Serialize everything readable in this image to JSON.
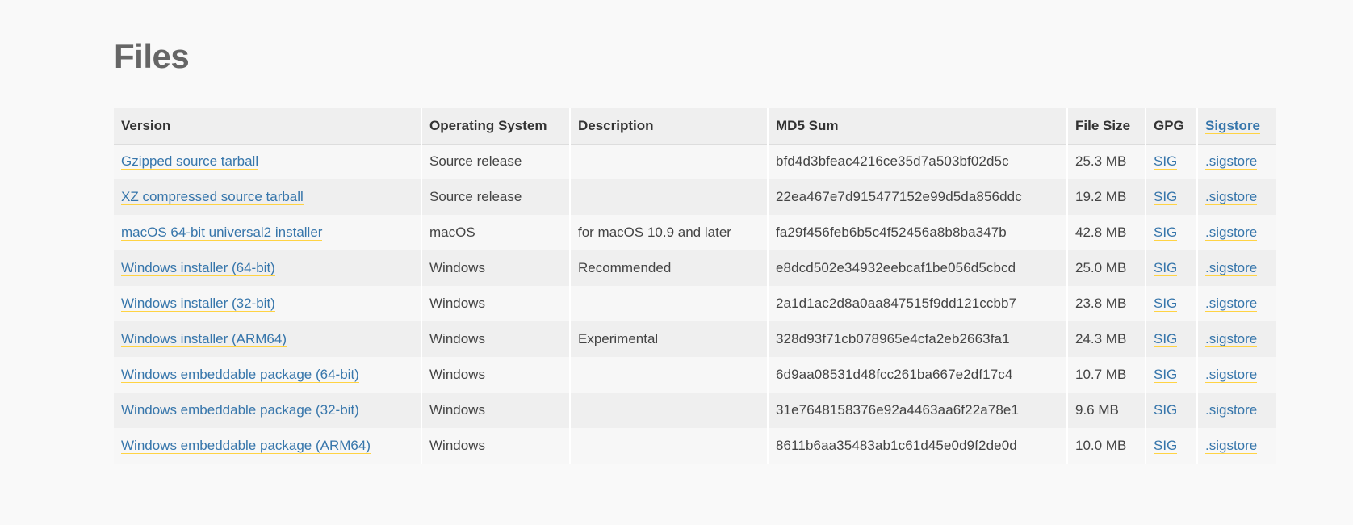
{
  "page": {
    "title": "Files"
  },
  "colors": {
    "link": "#3776ab",
    "link_underline": "#ffd343",
    "heading": "#666666",
    "header_bg": "#efefef",
    "row_alt_bg": "#efefef",
    "row_bg": "#f7f7f7",
    "page_bg": "#f9f9f9"
  },
  "table": {
    "headers": {
      "version": "Version",
      "os": "Operating System",
      "description": "Description",
      "md5": "MD5 Sum",
      "size": "File Size",
      "gpg": "GPG",
      "sigstore": "Sigstore"
    },
    "rows": [
      {
        "version": "Gzipped source tarball",
        "os": "Source release",
        "description": "",
        "md5": "bfd4d3bfeac4216ce35d7a503bf02d5c",
        "size": "25.3 MB",
        "gpg": "SIG",
        "sigstore": ".sigstore"
      },
      {
        "version": "XZ compressed source tarball",
        "os": "Source release",
        "description": "",
        "md5": "22ea467e7d915477152e99d5da856ddc",
        "size": "19.2 MB",
        "gpg": "SIG",
        "sigstore": ".sigstore"
      },
      {
        "version": "macOS 64-bit universal2 installer",
        "os": "macOS",
        "description": "for macOS 10.9 and later",
        "md5": "fa29f456feb6b5c4f52456a8b8ba347b",
        "size": "42.8 MB",
        "gpg": "SIG",
        "sigstore": ".sigstore"
      },
      {
        "version": "Windows installer (64-bit)",
        "os": "Windows",
        "description": "Recommended",
        "md5": "e8dcd502e34932eebcaf1be056d5cbcd",
        "size": "25.0 MB",
        "gpg": "SIG",
        "sigstore": ".sigstore"
      },
      {
        "version": "Windows installer (32-bit)",
        "os": "Windows",
        "description": "",
        "md5": "2a1d1ac2d8a0aa847515f9dd121ccbb7",
        "size": "23.8 MB",
        "gpg": "SIG",
        "sigstore": ".sigstore"
      },
      {
        "version": "Windows installer (ARM64)",
        "os": "Windows",
        "description": "Experimental",
        "md5": "328d93f71cb078965e4cfa2eb2663fa1",
        "size": "24.3 MB",
        "gpg": "SIG",
        "sigstore": ".sigstore"
      },
      {
        "version": "Windows embeddable package (64-bit)",
        "os": "Windows",
        "description": "",
        "md5": "6d9aa08531d48fcc261ba667e2df17c4",
        "size": "10.7 MB",
        "gpg": "SIG",
        "sigstore": ".sigstore"
      },
      {
        "version": "Windows embeddable package (32-bit)",
        "os": "Windows",
        "description": "",
        "md5": "31e7648158376e92a4463aa6f22a78e1",
        "size": "9.6 MB",
        "gpg": "SIG",
        "sigstore": ".sigstore"
      },
      {
        "version": "Windows embeddable package (ARM64)",
        "os": "Windows",
        "description": "",
        "md5": "8611b6aa35483ab1c61d45e0d9f2de0d",
        "size": "10.0 MB",
        "gpg": "SIG",
        "sigstore": ".sigstore"
      }
    ]
  }
}
